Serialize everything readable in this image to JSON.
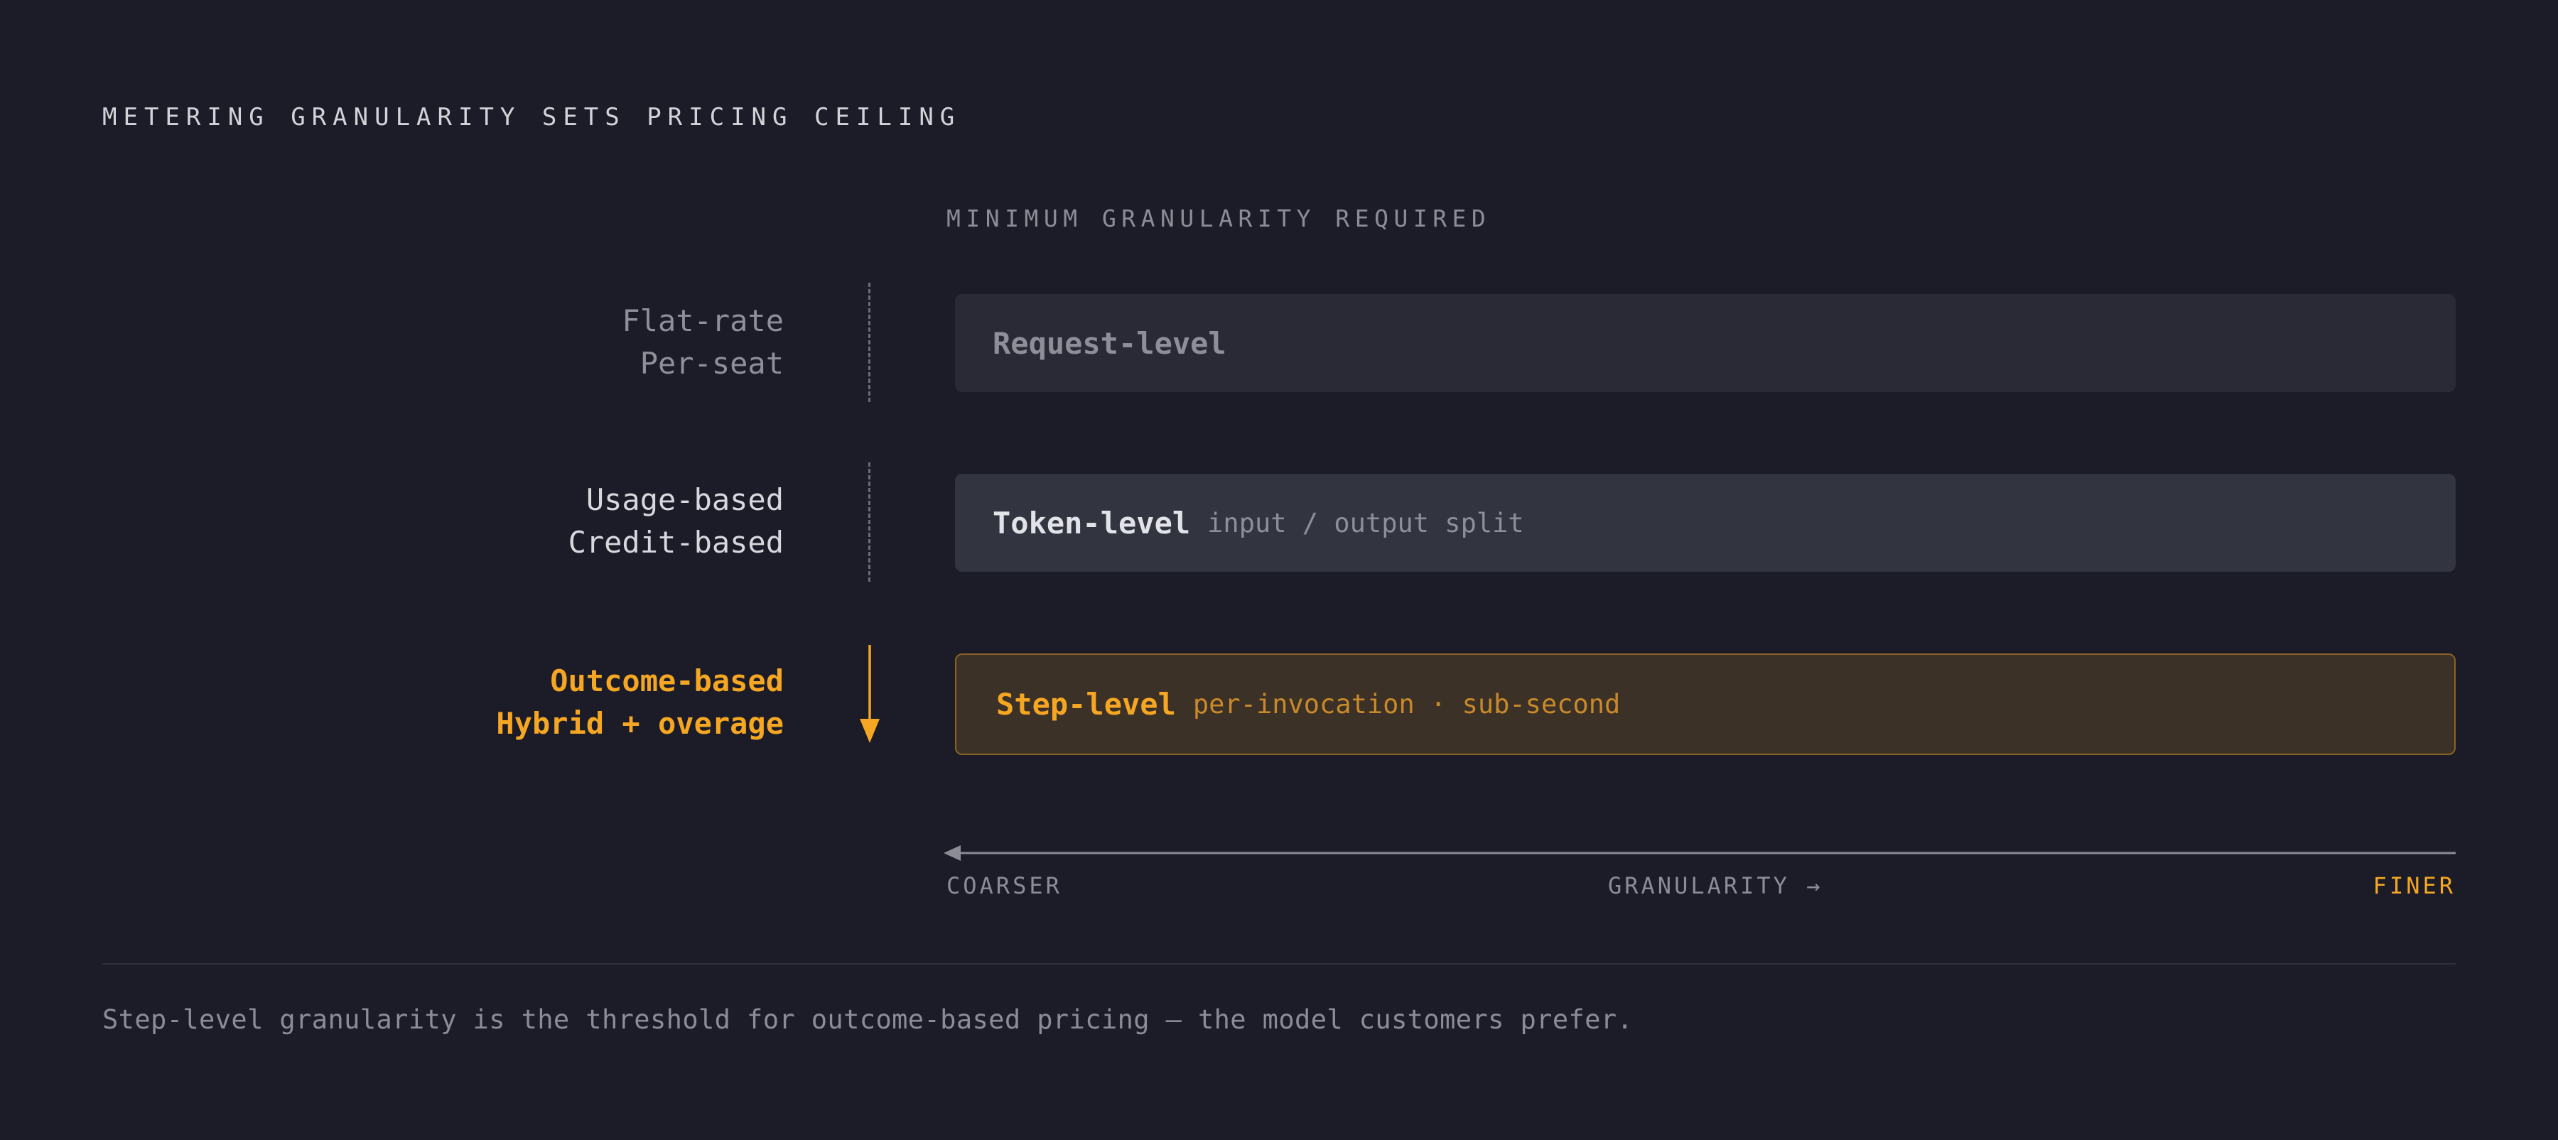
{
  "title": "METERING GRANULARITY SETS PRICING CEILING",
  "column_header": "MINIMUM GRANULARITY REQUIRED",
  "rows": [
    {
      "models": [
        "Flat-rate",
        "Per-seat"
      ],
      "granularity": "Request-level",
      "detail": ""
    },
    {
      "models": [
        "Usage-based",
        "Credit-based"
      ],
      "granularity": "Token-level",
      "detail": "input / output split"
    },
    {
      "models": [
        "Outcome-based",
        "Hybrid + overage"
      ],
      "granularity": "Step-level",
      "detail": "per-invocation · sub-second"
    }
  ],
  "axis": {
    "left_label": "COARSER",
    "center_label": "GRANULARITY →",
    "right_label": "FINER"
  },
  "footnote": "Step-level granularity is the threshold for outcome-based pricing — the model customers prefer.",
  "colors": {
    "background": "#1b1c27",
    "accent": "#f5a623",
    "muted": "#8b8c96"
  },
  "icons": {
    "connector": "dashed-line",
    "highlight_connector": "arrow-down-icon",
    "axis_arrow": "arrow-left-icon"
  }
}
